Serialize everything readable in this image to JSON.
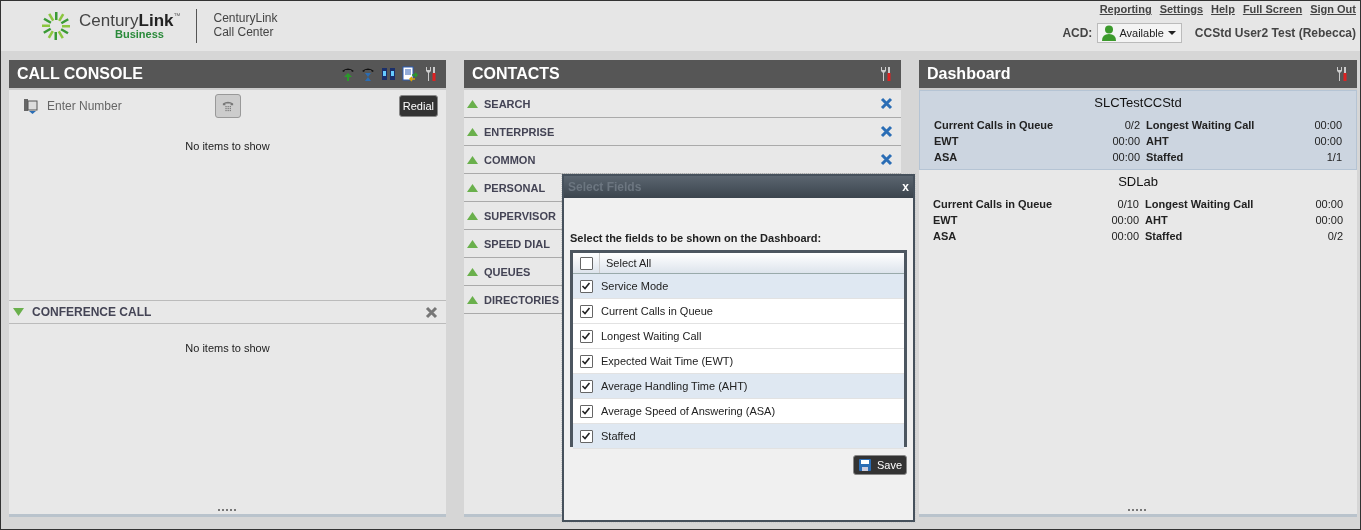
{
  "header": {
    "brand": "CenturyLink",
    "brand_tm": "™",
    "brand_sub": "Business",
    "product_line1": "CenturyLink",
    "product_line2": "Call Center",
    "links": [
      "Reporting",
      "Settings",
      "Help",
      "Full Screen",
      "Sign Out"
    ],
    "acd_label": "ACD:",
    "acd_status": "Available",
    "user": "CCStd User2 Test (Rebecca)"
  },
  "call_console": {
    "title": "CALL CONSOLE",
    "placeholder": "Enter Number",
    "redial": "Redial",
    "empty": "No items to show",
    "conference": {
      "title": "CONFERENCE CALL",
      "expanded": true,
      "empty": "No items to show"
    }
  },
  "contacts": {
    "title": "CONTACTS",
    "sections": [
      {
        "label": "SEARCH",
        "expanded": false,
        "removable": true
      },
      {
        "label": "ENTERPRISE",
        "expanded": false,
        "removable": true
      },
      {
        "label": "COMMON",
        "expanded": false,
        "removable": true
      },
      {
        "label": "PERSONAL",
        "expanded": false
      },
      {
        "label": "SUPERVISOR",
        "expanded": false
      },
      {
        "label": "SPEED DIAL",
        "expanded": false
      },
      {
        "label": "QUEUES",
        "expanded": false
      },
      {
        "label": "DIRECTORIES",
        "expanded": false
      }
    ]
  },
  "dashboard": {
    "title": "Dashboard",
    "queues": [
      {
        "name": "SLCTestCCStd",
        "selected": true,
        "stats": [
          [
            "Current Calls in Queue",
            "0/2",
            "Longest Waiting Call",
            "00:00"
          ],
          [
            "EWT",
            "00:00",
            "AHT",
            "00:00"
          ],
          [
            "ASA",
            "00:00",
            "Staffed",
            "1/1"
          ]
        ]
      },
      {
        "name": "SDLab",
        "selected": false,
        "stats": [
          [
            "Current Calls in Queue",
            "0/10",
            "Longest Waiting Call",
            "00:00"
          ],
          [
            "EWT",
            "00:00",
            "AHT",
            "00:00"
          ],
          [
            "ASA",
            "00:00",
            "Staffed",
            "0/2"
          ]
        ]
      }
    ]
  },
  "dialog": {
    "title": "Select Fields",
    "close": "x",
    "instruction": "Select the fields to be shown on the Dashboard:",
    "select_all": {
      "label": "Select All",
      "checked": false
    },
    "fields": [
      {
        "label": "Service Mode",
        "checked": true,
        "selected": true
      },
      {
        "label": "Current Calls in Queue",
        "checked": true,
        "selected": false
      },
      {
        "label": "Longest Waiting Call",
        "checked": true,
        "selected": false
      },
      {
        "label": "Expected Wait Time (EWT)",
        "checked": true,
        "selected": false
      },
      {
        "label": "Average Handling Time (AHT)",
        "checked": true,
        "selected": true
      },
      {
        "label": "Average Speed of Answering (ASA)",
        "checked": true,
        "selected": false
      },
      {
        "label": "Staffed",
        "checked": true,
        "selected": true
      }
    ],
    "save": "Save"
  }
}
